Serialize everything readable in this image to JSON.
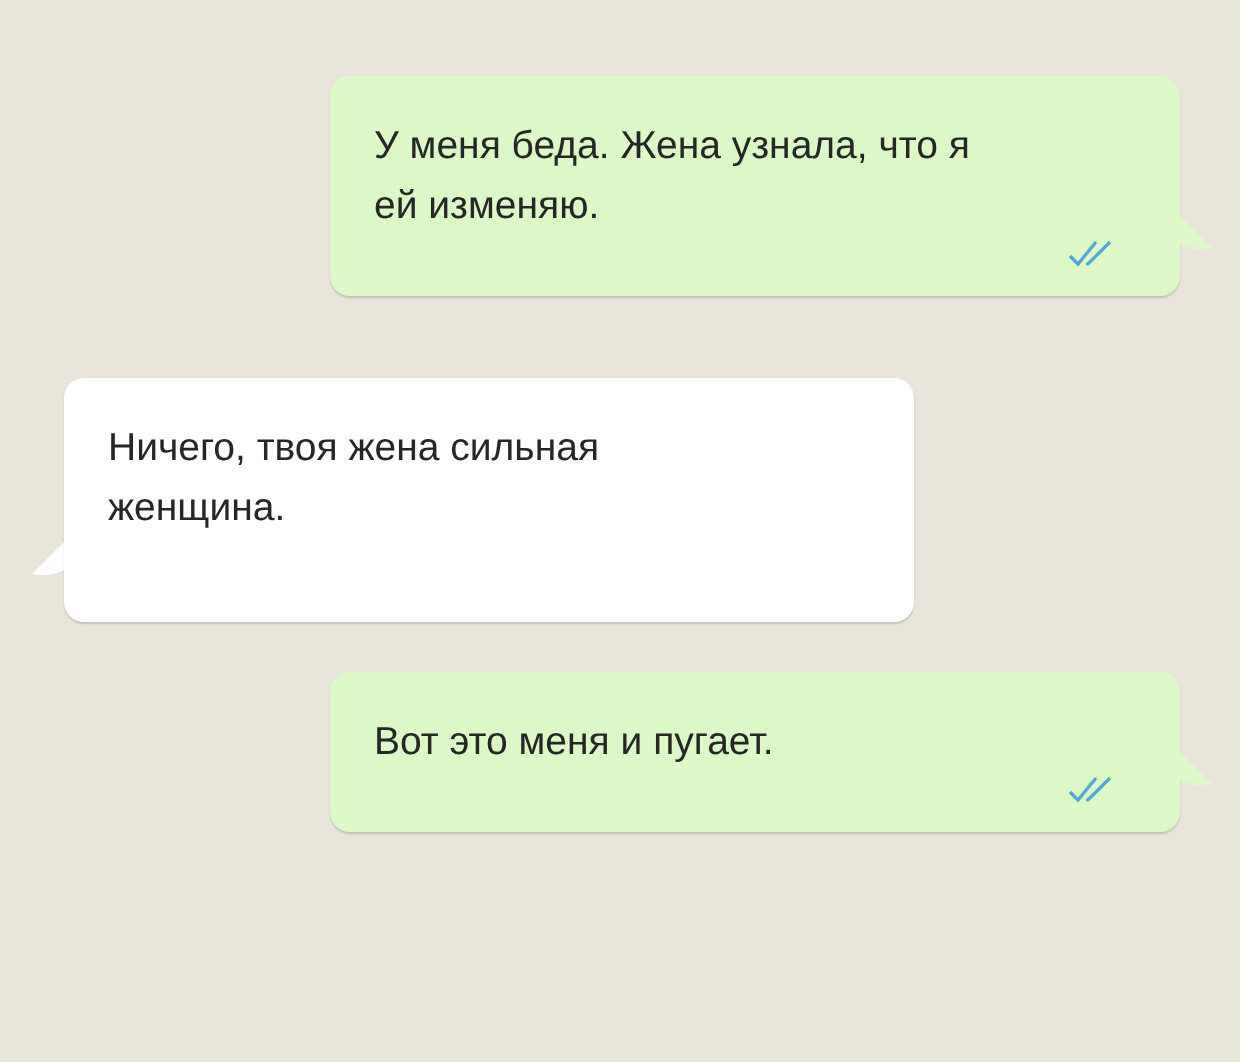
{
  "messages": [
    {
      "kind": "outgoing",
      "text": "У меня беда. Жена узнала, что я ей изменяю.",
      "read": true
    },
    {
      "kind": "incoming",
      "text": "Ничего, твоя жена сильная женщина."
    },
    {
      "kind": "outgoing",
      "text": "Вот это меня и пугает.",
      "read": true
    }
  ]
}
